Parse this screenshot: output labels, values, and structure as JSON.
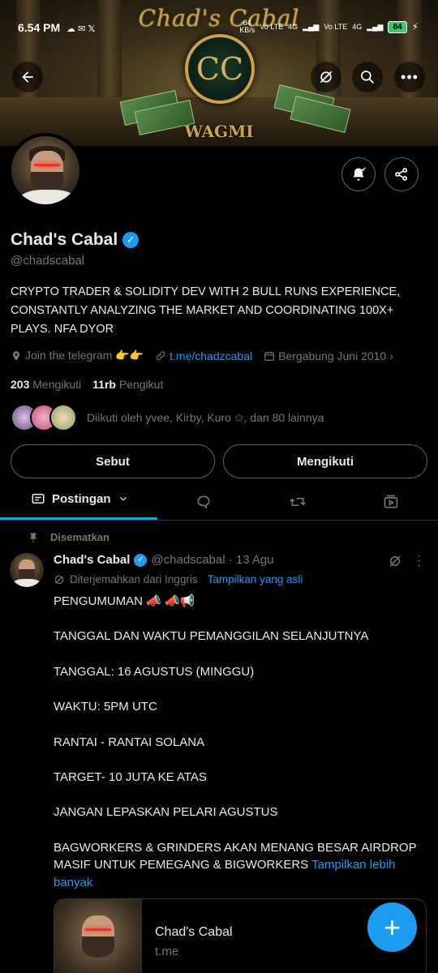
{
  "status_bar": {
    "time": "6.54 PM",
    "network_speed": "84\nKB/s",
    "net1": "Vo LTE",
    "net2": "4G",
    "net3": "Vo LTE",
    "net4": "4G",
    "battery": "84"
  },
  "banner": {
    "title": "Chad's Cabal",
    "seal_text": "CC",
    "footer": "WAGMI"
  },
  "profile": {
    "name": "Chad's Cabal",
    "handle": "@chadscabal",
    "bio": "CRYPTO TRADER & SOLIDITY DEV WITH 2 BULL RUNS EXPERIENCE, CONSTANTLY ANALYZING THE MARKET AND COORDINATING 100X+ PLAYS. NFA DYOR",
    "location": "Join the telegram 👉👉",
    "link": "t.me/chadzcabal",
    "joined": "Bergabung Juni 2010",
    "following_count": "203",
    "following_label": "Mengikuti",
    "followers_count": "11rb",
    "followers_label": "Pengikut",
    "followed_by": "Diikuti oleh yvee, Kirby, Kuro ✩, dan 80 lainnya"
  },
  "actions": {
    "mention": "Sebut",
    "following": "Mengikuti"
  },
  "tabs": {
    "active": "Postingan"
  },
  "tweet": {
    "pinned_label": "Disematkan",
    "name": "Chad's Cabal",
    "meta": "@chadscabal · 13 Agu",
    "translated": "Diterjemahkan dari Inggris",
    "show_original": "Tampilkan yang asli",
    "lines": [
      "PENGUMUMAN 📣 📣📢",
      "",
      "TANGGAL DAN WAKTU PEMANGGILAN SELANJUTNYA",
      "",
      "TANGGAL: 16 AGUSTUS (MINGGU)",
      "",
      "WAKTU: 5PM UTC",
      "",
      "RANTAI - RANTAI SOLANA",
      "",
      "TARGET- 10 JUTA KE ATAS",
      "",
      "JANGAN LEPASKAN PELARI AGUSTUS",
      "",
      "BAGWORKERS & GRINDERS AKAN MENANG BESAR AIRDROP MASIF UNTUK PEMEGANG & BIGWORKERS"
    ],
    "show_more": "Tampilkan lebih banyak",
    "card_title": "Chad's Cabal",
    "card_domain": "t.me"
  },
  "colors": {
    "accent": "#1d9bf0",
    "background": "#000000",
    "muted": "#71767b"
  }
}
